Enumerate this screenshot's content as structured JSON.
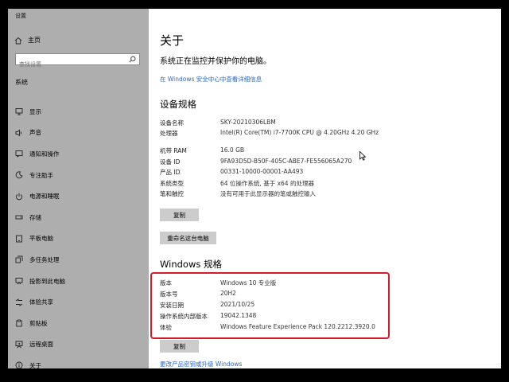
{
  "window": {
    "title": "设置"
  },
  "sidebar": {
    "home_label": "主页",
    "search_placeholder": "查找设置",
    "section_label": "系统",
    "items": [
      {
        "label": "显示",
        "icon": "display-icon"
      },
      {
        "label": "声音",
        "icon": "sound-icon"
      },
      {
        "label": "通知和操作",
        "icon": "notifications-icon"
      },
      {
        "label": "专注助手",
        "icon": "focus-assist-icon"
      },
      {
        "label": "电源和睡眠",
        "icon": "power-icon"
      },
      {
        "label": "存储",
        "icon": "storage-icon"
      },
      {
        "label": "平板电脑",
        "icon": "tablet-icon"
      },
      {
        "label": "多任务处理",
        "icon": "multitasking-icon"
      },
      {
        "label": "投影到此电脑",
        "icon": "projecting-icon"
      },
      {
        "label": "体验共享",
        "icon": "shared-experiences-icon"
      },
      {
        "label": "剪贴板",
        "icon": "clipboard-icon"
      },
      {
        "label": "远程桌面",
        "icon": "remote-desktop-icon"
      },
      {
        "label": "关于",
        "icon": "about-icon"
      }
    ]
  },
  "main": {
    "title": "关于",
    "security_message": "系统正在监控并保护你的电脑。",
    "security_link": "在 Windows 安全中心中查看详细信息",
    "device_spec": {
      "heading": "设备规格",
      "rows": [
        {
          "key": "设备名称",
          "value": "SKY-20210306LBM"
        },
        {
          "key": "处理器",
          "value": "Intel(R) Core(TM) i7-7700K CPU @ 4.20GHz   4.20 GHz"
        },
        {
          "key": "机带 RAM",
          "value": "16.0 GB"
        },
        {
          "key": "设备 ID",
          "value": "9FA93D5D-B50F-405C-ABE7-FE556065A270"
        },
        {
          "key": "产品 ID",
          "value": "00331-10000-00001-AA493"
        },
        {
          "key": "系统类型",
          "value": "64 位操作系统, 基于 x64 的处理器"
        },
        {
          "key": "笔和触控",
          "value": "没有可用于此显示器的笔或触控输入"
        }
      ],
      "copy_label": "复制",
      "rename_label": "重命名这台电脑"
    },
    "windows_spec": {
      "heading": "Windows 规格",
      "rows": [
        {
          "key": "版本",
          "value": "Windows 10 专业版"
        },
        {
          "key": "版本号",
          "value": "20H2"
        },
        {
          "key": "安装日期",
          "value": "2021/10/25"
        },
        {
          "key": "操作系统内部版本",
          "value": "19042.1348"
        },
        {
          "key": "体验",
          "value": "Windows Feature Experience Pack 120.2212.3920.0"
        }
      ],
      "copy_label": "复制",
      "upgrade_link": "更改产品密钥或升级 Windows"
    }
  },
  "colors": {
    "sidebar_bg": "#aeaeae",
    "link": "#2b66c4",
    "highlight_border": "#d51a2a",
    "button_bg": "#cccccc"
  }
}
